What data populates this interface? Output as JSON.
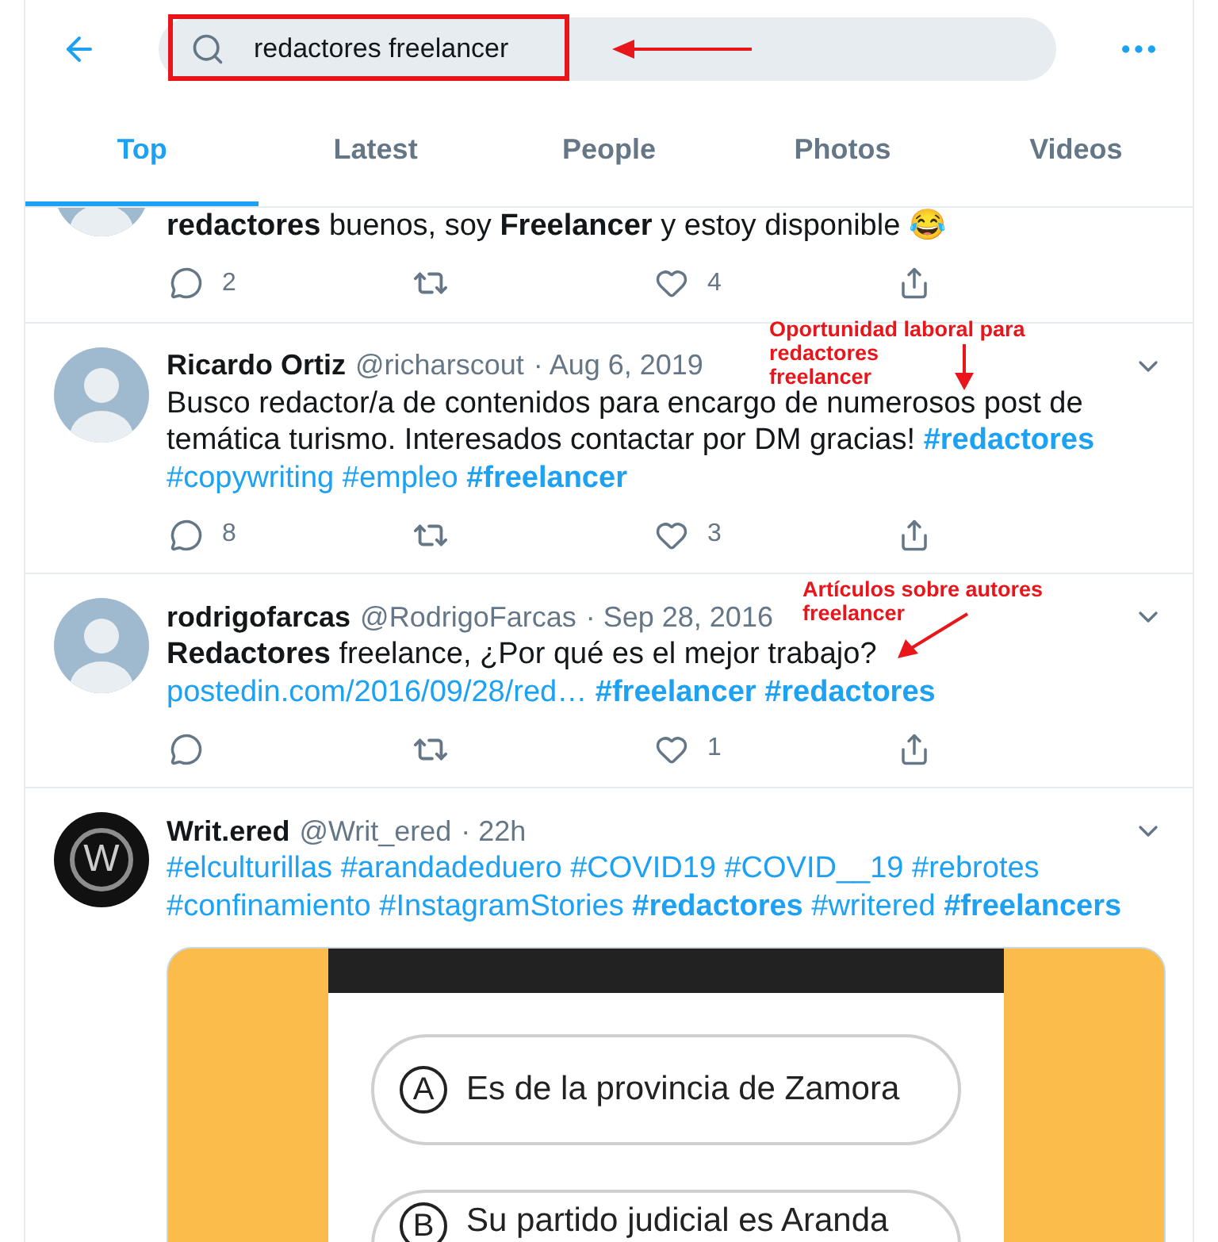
{
  "search": {
    "value": "redactores freelancer",
    "highlighted": true
  },
  "tabs": [
    {
      "label": "Top",
      "selected": true
    },
    {
      "label": "Latest",
      "selected": false
    },
    {
      "label": "People",
      "selected": false
    },
    {
      "label": "Photos",
      "selected": false
    },
    {
      "label": "Videos",
      "selected": false
    }
  ],
  "tweets": [
    {
      "clipped": true,
      "segments": [
        {
          "kind": "text",
          "text": "**redactores** buenos, soy **Freelancer** y estoy disponible 😂"
        }
      ],
      "actions": {
        "replies": "2",
        "likes": "4"
      }
    },
    {
      "name": "Ricardo Ortiz",
      "handle": "@richarscout",
      "date": "· Aug 6, 2019",
      "segments": [
        {
          "kind": "text",
          "text": "Busco redactor/a de contenidos para encargo de numerosos post de temática turismo. Interesados contactar por DM gracias!"
        },
        {
          "kind": "tag",
          "text": "#redactores",
          "bold": true
        },
        {
          "kind": "tag",
          "text": "#copywriting",
          "bold": false
        },
        {
          "kind": "tag",
          "text": "#empleo",
          "bold": false
        },
        {
          "kind": "tag",
          "text": "#freelancer",
          "bold": true
        }
      ],
      "actions": {
        "replies": "8",
        "likes": "3"
      },
      "annotation": {
        "lines": [
          "Oportunidad laboral para",
          "redactores",
          "freelancer"
        ]
      }
    },
    {
      "name": "rodrigofarcas",
      "handle": "@RodrigoFarcas",
      "date": "· Sep 28, 2016",
      "segments": [
        {
          "kind": "text",
          "text": "**Redactores** freelance, ¿Por qué es el mejor trabajo?"
        },
        {
          "kind": "url",
          "text": "postedin.com/2016/09/28/red…",
          "bold": false
        },
        {
          "kind": "tag",
          "text": "#freelancer",
          "bold": true
        },
        {
          "kind": "tag",
          "text": "#redactores",
          "bold": true
        }
      ],
      "actions": {
        "likes": "1"
      },
      "annotation": {
        "lines": [
          "Artículos sobre autores",
          "freelancer"
        ]
      }
    },
    {
      "name": "Writ.ered",
      "handle": "@Writ_ered",
      "date": "· 22h",
      "avatar_letter": "W",
      "segments": [
        {
          "kind": "tag",
          "text": "#elculturillas",
          "bold": false
        },
        {
          "kind": "tag",
          "text": "#arandadeduero",
          "bold": false
        },
        {
          "kind": "tag",
          "text": "#COVID19",
          "bold": false
        },
        {
          "kind": "tag",
          "text": "#COVID__19",
          "bold": false
        },
        {
          "kind": "tag",
          "text": "#rebrotes",
          "bold": false
        },
        {
          "kind": "tag",
          "text": "#confinamiento",
          "bold": false
        },
        {
          "kind": "tag",
          "text": "#InstagramStories",
          "bold": false
        },
        {
          "kind": "tag",
          "text": "#redactores",
          "bold": true
        },
        {
          "kind": "tag",
          "text": "#writered",
          "bold": false
        },
        {
          "kind": "tag",
          "text": "#freelancers",
          "bold": true
        }
      ],
      "media": {
        "options": [
          {
            "letter": "A",
            "text": "Es de la provincia de Zamora"
          },
          {
            "letter": "B",
            "text": "Su partido judicial es Aranda"
          }
        ]
      }
    }
  ]
}
